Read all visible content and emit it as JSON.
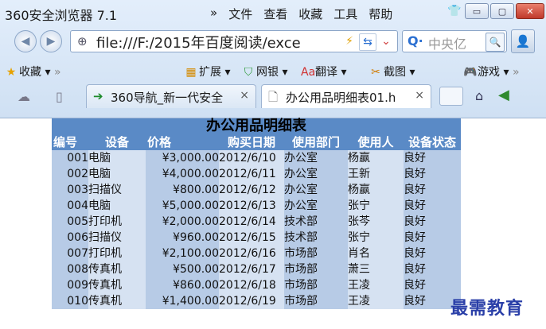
{
  "window": {
    "title": "360安全浏览器 7.1",
    "menu_more": "»",
    "menu": [
      "文件",
      "查看",
      "收藏",
      "工具",
      "帮助"
    ],
    "controls": {
      "minimize": "▭",
      "maximize": "▢",
      "close": "✕"
    }
  },
  "address_bar": {
    "url_visible": "file:///F:/2015年百度阅读/exce",
    "search_placeholder": "中央亿"
  },
  "favorites_bar": {
    "favorites_label": "收藏",
    "extensions_label": "扩展",
    "bank_label": "网银",
    "translate_label": "翻译",
    "screenshot_label": "截图",
    "games_label": "游戏"
  },
  "tabs": [
    {
      "label": "360导航_新一代安全",
      "close": "×",
      "active": false
    },
    {
      "label": "办公用品明细表01.h",
      "close": "×",
      "active": true
    }
  ],
  "sheet": {
    "title": "办公用品明细表",
    "headers": [
      "编号",
      "设备",
      "价格",
      "购买日期",
      "使用部门",
      "使用人",
      "设备状态"
    ],
    "rows": [
      [
        "001",
        "电脑",
        "¥3,000.00",
        "2012/6/10",
        "办公室",
        "杨赢",
        "良好"
      ],
      [
        "002",
        "电脑",
        "¥4,000.00",
        "2012/6/11",
        "办公室",
        "王新",
        "良好"
      ],
      [
        "003",
        "扫描仪",
        "¥800.00",
        "2012/6/12",
        "办公室",
        "杨赢",
        "良好"
      ],
      [
        "004",
        "电脑",
        "¥5,000.00",
        "2012/6/13",
        "办公室",
        "张宁",
        "良好"
      ],
      [
        "005",
        "打印机",
        "¥2,000.00",
        "2012/6/14",
        "技术部",
        "张芩",
        "良好"
      ],
      [
        "006",
        "扫描仪",
        "¥960.00",
        "2012/6/15",
        "技术部",
        "张宁",
        "良好"
      ],
      [
        "007",
        "打印机",
        "¥2,100.00",
        "2012/6/16",
        "市场部",
        "肖名",
        "良好"
      ],
      [
        "008",
        "传真机",
        "¥500.00",
        "2012/6/17",
        "市场部",
        "萧三",
        "良好"
      ],
      [
        "009",
        "传真机",
        "¥860.00",
        "2012/6/18",
        "市场部",
        "王凌",
        "良好"
      ],
      [
        "010",
        "传真机",
        "¥1,400.00",
        "2012/6/19",
        "市场部",
        "王凌",
        "良好"
      ]
    ]
  },
  "watermark": "最需教育",
  "colors": {
    "header_bg": "#5a8ac6",
    "row_bg": "#b7cbe6",
    "row_alt_bg": "#d6e2f2",
    "watermark": "#2a3fa8"
  }
}
